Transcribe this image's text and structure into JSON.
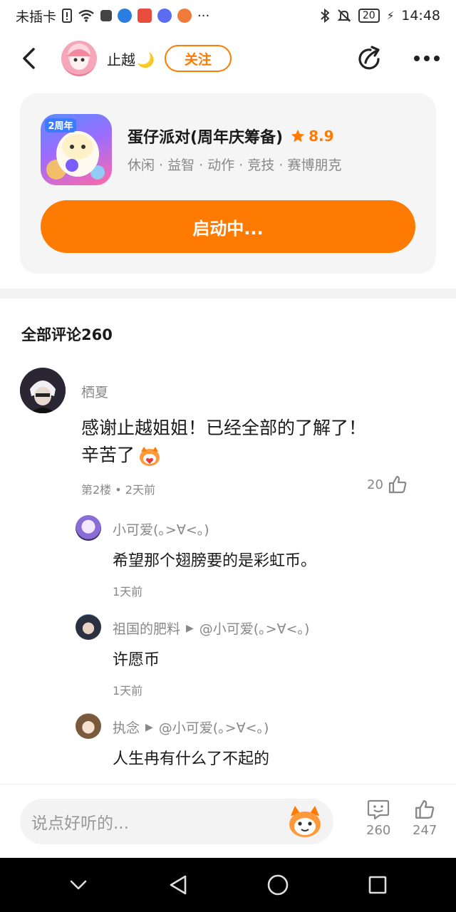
{
  "status_bar": {
    "carrier": "未插卡",
    "battery": "20",
    "time": "14:48",
    "icons": [
      "sim-alert-icon",
      "wifi-icon",
      "app-icon",
      "app-icon",
      "app-icon",
      "music-icon",
      "app-icon",
      "more-dots-icon",
      "bluetooth-icon",
      "mute-icon",
      "battery-icon",
      "charging-icon"
    ]
  },
  "header": {
    "username": "止越",
    "username_suffix": "🌙",
    "follow_label": "关注"
  },
  "game": {
    "title": "蛋仔派对(周年庆筹备)",
    "rating": "8.9",
    "tags": "休闲 · 益智 · 动作 · 竞技 · 赛博朋克",
    "launch_label": "启动中...",
    "icon_badge": "2周年"
  },
  "comments": {
    "title": "全部评论260",
    "main": {
      "author": "栖夏",
      "text_line1": "感谢止越姐姐！已经全部的了解了！",
      "text_line2": "辛苦了",
      "meta": "第2楼 • 2天前",
      "likes": "20"
    },
    "replies": [
      {
        "author": "小可爱(｡>∀<｡)",
        "target": "",
        "text": "希望那个翅膀要的是彩虹币。",
        "time": "1天前"
      },
      {
        "author": "祖国的肥料",
        "target": "@小可爱(｡>∀<｡)",
        "text": "许愿币",
        "time": "1天前"
      },
      {
        "author": "执念",
        "target": "@小可爱(｡>∀<｡)",
        "text": "人生冉有什么了不起的",
        "time": ""
      }
    ]
  },
  "bottom_bar": {
    "input_placeholder": "说点好听的...",
    "comment_count": "260",
    "like_count": "247"
  },
  "colors": {
    "accent": "#ff7a00",
    "muted": "#888888",
    "card_bg": "#f5f5f5"
  }
}
